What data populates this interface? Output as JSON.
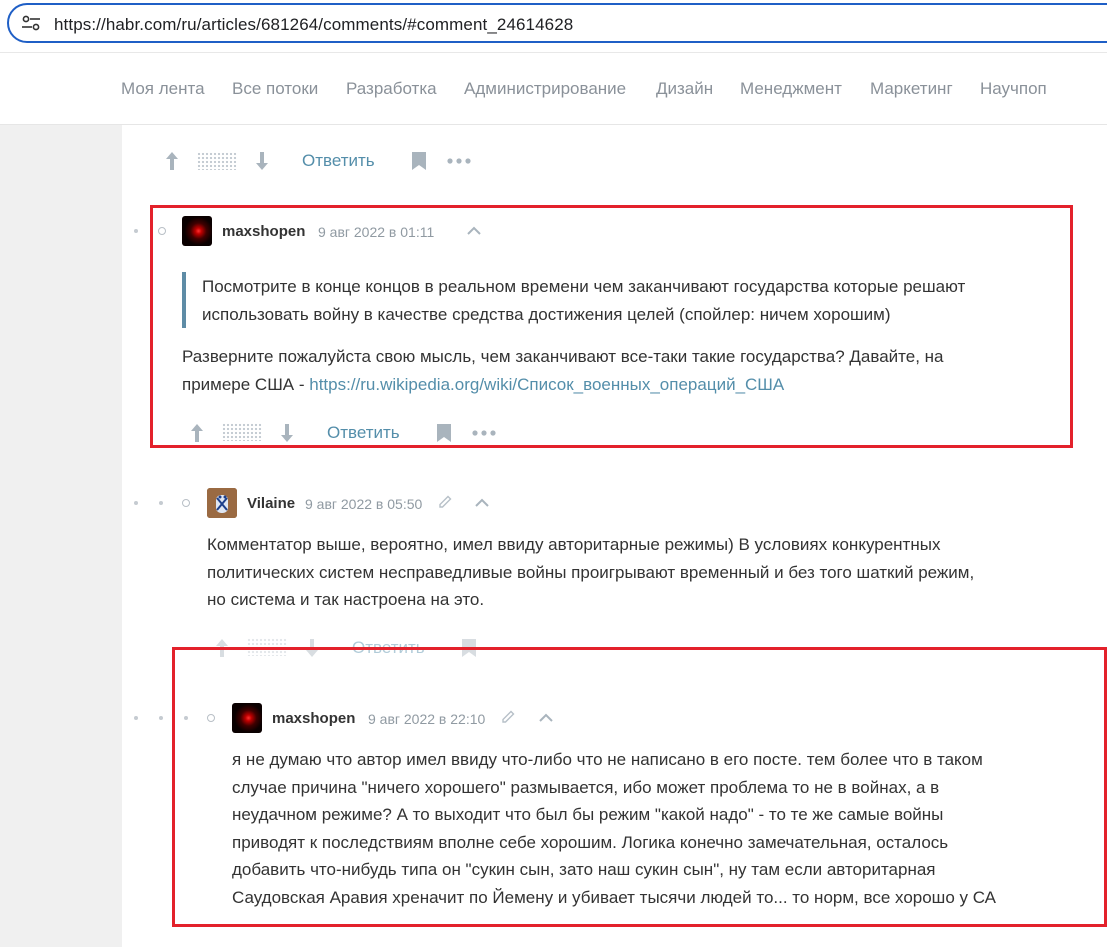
{
  "browser": {
    "url": "https://habr.com/ru/articles/681264/comments/#comment_24614628"
  },
  "nav": {
    "items": [
      "Моя лента",
      "Все потоки",
      "Разработка",
      "Администрирование",
      "Дизайн",
      "Менеджмент",
      "Маркетинг",
      "Научпоп"
    ]
  },
  "comments": [
    {
      "controls": {
        "reply": "Ответить"
      }
    },
    {
      "author": "maxshopen",
      "date": "9 авг 2022 в 01:11",
      "quote_lines": [
        "Посмотрите в конце концов в реальном времени чем заканчивают государства которые решают",
        "использовать войну в качестве средства достижения целей (спойлер: ничем хорошим)"
      ],
      "body_line1": "Разверните пожалуйста свою мысль, чем заканчивают все-таки такие государства? Давайте, на",
      "body_line2_prefix": "примере США - ",
      "body_link": "https://ru.wikipedia.org/wiki/Список_военных_операций_США",
      "controls": {
        "reply": "Ответить"
      }
    },
    {
      "author": "Vilaine",
      "date": "9 авг 2022 в 05:50",
      "body_lines": [
        "Комментатор выше, вероятно, имел ввиду авторитарные режимы) В условиях конкурентных",
        "политических систем несправедливые войны проигрывают временный и без того шаткий режим,",
        "но система и так настроена на это."
      ],
      "controls": {
        "reply": "Ответить"
      }
    },
    {
      "author": "maxshopen",
      "date": "9 авг 2022 в 22:10",
      "body_lines": [
        "я не думаю что автор имел ввиду что-либо что не написано в его посте. тем более что в таком",
        "случае причина \"ничего хорошего\" размывается, ибо может проблема то не в войнах, а в",
        "неудачном режиме? А то выходит что был бы режим \"какой надо\" - то те же самые войны",
        "приводят к последствиям вполне себе хорошим. Логика конечно замечательная, осталось",
        "добавить что-нибудь типа он \"сукин сын, зато наш сукин сын\", ну там если авторитарная",
        "Саудовская Аравия хреначит по Йемену и убивает тысячи людей то... то норм, все хорошо у СА"
      ]
    }
  ],
  "colors": {
    "highlight": "#e3212b",
    "link": "#548eaa",
    "quote_bar": "#5e8ca6"
  }
}
